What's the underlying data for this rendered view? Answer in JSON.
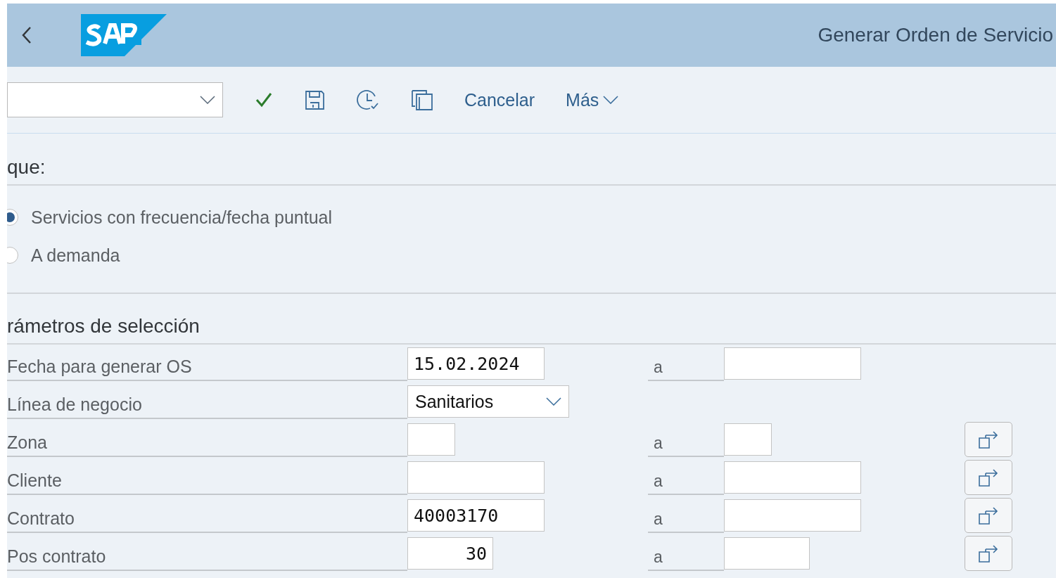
{
  "header": {
    "title": "Generar Orden de Servicio"
  },
  "toolbar": {
    "actions": [
      {
        "kind": "check"
      },
      {
        "kind": "save"
      },
      {
        "kind": "history"
      },
      {
        "kind": "copy"
      },
      {
        "kind": "text",
        "label": "Cancelar"
      },
      {
        "kind": "menu",
        "label": "Más"
      }
    ]
  },
  "block": {
    "title": "que:",
    "options": [
      {
        "label": "Servicios con frecuencia/fecha puntual",
        "selected": true
      },
      {
        "label": "A demanda",
        "selected": false
      }
    ]
  },
  "selection": {
    "title": "rámetros de selección",
    "rows": [
      {
        "label": "Fecha para generar OS",
        "kind": "range",
        "value": "15.02.2024",
        "to_label": "a",
        "multiple": false
      },
      {
        "label": "Línea de negocio",
        "kind": "select",
        "value": "Sanitarios"
      },
      {
        "label": "Zona",
        "kind": "range",
        "to_label": "a",
        "multiple": true
      },
      {
        "label": "Cliente",
        "kind": "range",
        "to_label": "a",
        "multiple": true
      },
      {
        "label": "Contrato",
        "kind": "range",
        "value": "40003170",
        "to_label": "a",
        "multiple": true
      },
      {
        "label": "Pos contrato",
        "kind": "range",
        "value": "30",
        "to_label": "a",
        "multiple": true
      }
    ]
  }
}
